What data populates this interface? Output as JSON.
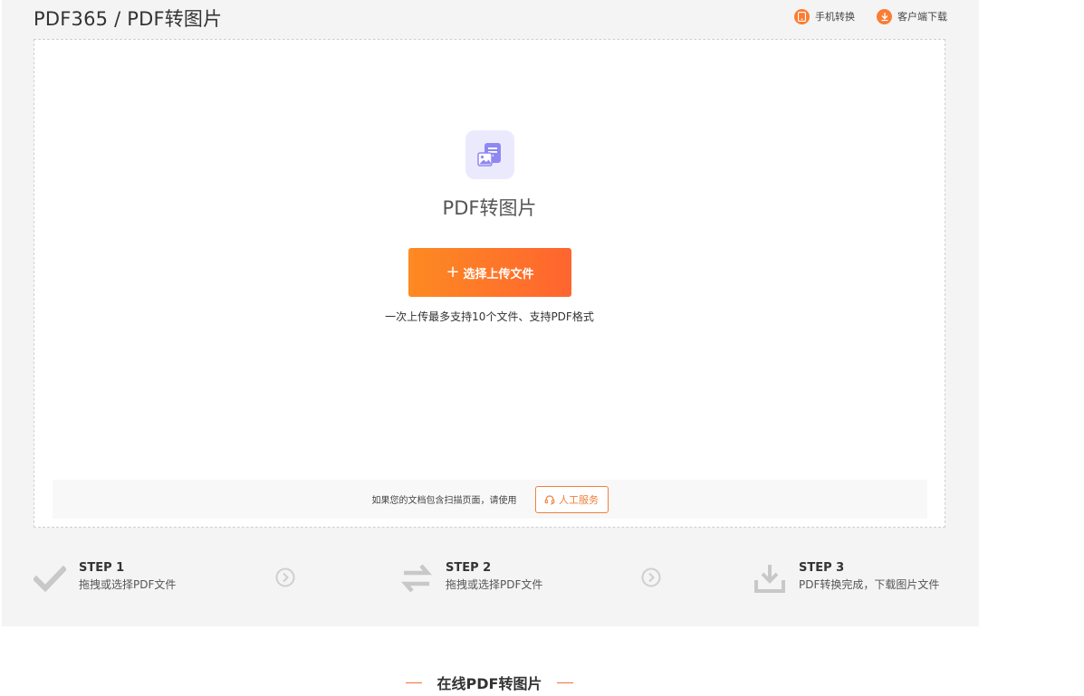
{
  "header": {
    "title": "PDF365 / PDF转图片",
    "links": [
      {
        "label": "手机转换",
        "icon": "mobile-icon"
      },
      {
        "label": "客户端下载",
        "icon": "download-icon"
      }
    ]
  },
  "upload": {
    "icon": "pdf-to-image-icon",
    "tool_title": "PDF转图片",
    "button_label": "选择上传文件",
    "note": "一次上传最多支持10个文件、支持PDF格式"
  },
  "notice": {
    "text": "如果您的文档包含扫描页面，请使用",
    "service_label": "人工服务"
  },
  "steps": [
    {
      "label": "STEP 1",
      "desc": "拖拽或选择PDF文件",
      "icon": "check-icon"
    },
    {
      "label": "STEP 2",
      "desc": "拖拽或选择PDF文件",
      "icon": "convert-icon"
    },
    {
      "label": "STEP 3",
      "desc": "PDF转换完成，下载图片文件",
      "icon": "download-tray-icon"
    }
  ],
  "section": {
    "heading": "在线PDF转图片"
  },
  "colors": {
    "accent": "#fe652f",
    "accent_light": "#fd8a22",
    "panel_bg": "#f4f4f4",
    "icon_bg": "#ebeafd",
    "icon_fg": "#8f88f2"
  }
}
